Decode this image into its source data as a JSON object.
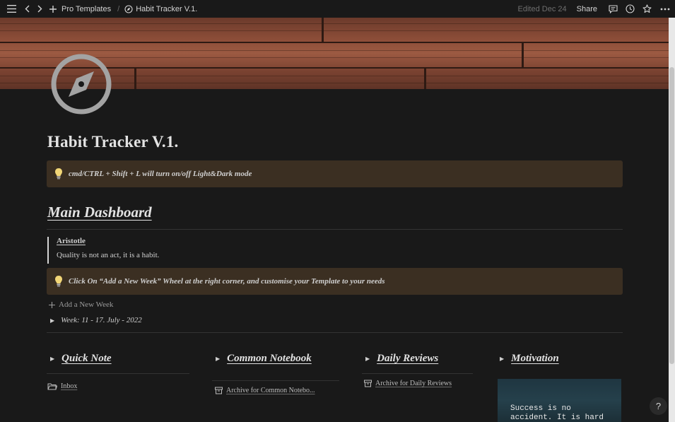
{
  "topbar": {
    "breadcrumb_parent": "Pro Templates",
    "breadcrumb_page": "Habit Tracker V.1.",
    "edited": "Edited Dec 24",
    "share": "Share"
  },
  "page": {
    "title": "Habit Tracker V.1.",
    "tip_callout": "cmd/CTRL + Shift + L will turn on/off Light&Dark mode",
    "main_heading": "Main Dashboard",
    "quote_author": "Aristotle",
    "quote_text": "Quality is not an act, it is a habit.",
    "week_callout": "Click On “Add a New Week” Wheel at the right corner,  and customise your Template to your needs",
    "add_week": "Add a New Week",
    "week_toggle": "Week: 11 - 17. July - 2022"
  },
  "columns": [
    {
      "title": "Quick Note",
      "link": "Inbox"
    },
    {
      "title": "Common Notebook",
      "link": "Archive for Common Notebo..."
    },
    {
      "title": "Daily Reviews",
      "link": "Archive for Daily Reviews"
    },
    {
      "title": "Motivation",
      "card_text": "Success is no accident. It is hard"
    }
  ],
  "help": "?",
  "colors": {
    "background": "#191919",
    "callout": "#3b2f22",
    "text": "#d4d4d4"
  }
}
